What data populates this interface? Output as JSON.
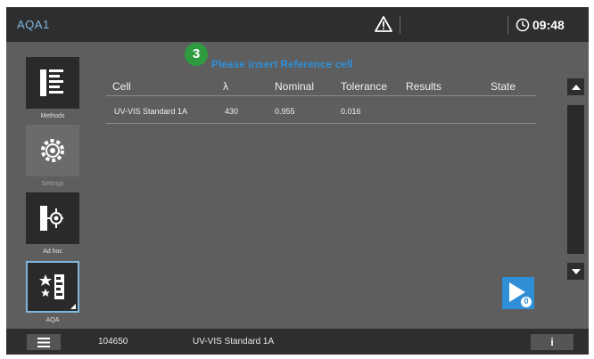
{
  "header": {
    "app_title": "AQA1",
    "warning_icon": "warning-triangle-icon",
    "clock_icon": "clock-icon",
    "time": "09:48"
  },
  "sidebar": {
    "items": [
      {
        "label": "Methods",
        "icon": "methods-icon"
      },
      {
        "label": "Settings",
        "icon": "gear-icon"
      },
      {
        "label": "Ad hoc",
        "icon": "ad-hoc-icon"
      },
      {
        "label": "AQA",
        "icon": "aqa-icon",
        "selected": true
      }
    ]
  },
  "step_badge": "3",
  "prompt": "Please insert Reference cell",
  "table": {
    "columns": [
      "Cell",
      "λ",
      "Nominal",
      "Tolerance",
      "Results",
      "State"
    ],
    "rows": [
      {
        "cell": "UV-VIS Standard 1A",
        "lambda": "430",
        "nominal": "0.955",
        "tolerance": "0.016",
        "results": "",
        "state": ""
      }
    ]
  },
  "start_button": {
    "icon": "play-icon",
    "badge": "0"
  },
  "footer": {
    "menu_icon": "hamburger-menu-icon",
    "id": "104650",
    "standard": "UV-VIS Standard 1A",
    "info_label": "i"
  },
  "colors": {
    "accent": "#2f8fd6",
    "badge_green": "#2e9b3f",
    "background": "#5e5e5e",
    "bar": "#2e2e2e"
  }
}
